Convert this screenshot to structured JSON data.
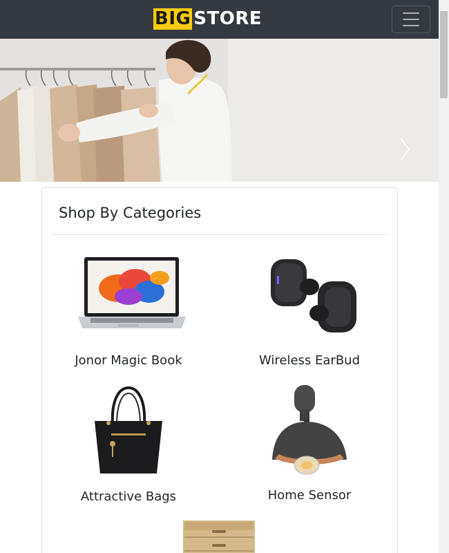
{
  "navbar": {
    "logo_big": "BIG",
    "logo_store": "STORE",
    "menu_icon": "hamburger-icon"
  },
  "hero": {
    "next_icon": "chevron-right-icon"
  },
  "categories": {
    "title": "Shop By Categories",
    "items": [
      {
        "label": "Jonor Magic Book",
        "icon": "laptop-image"
      },
      {
        "label": "Wireless EarBud",
        "icon": "earbuds-image"
      },
      {
        "label": "Attractive Bags",
        "icon": "handbag-image"
      },
      {
        "label": "Home Sensor",
        "icon": "lamp-image"
      },
      {
        "label": "",
        "icon": "drawer-cabinet-image"
      }
    ]
  },
  "colors": {
    "navbar_bg": "#343a40",
    "logo_accent": "#fccc0a"
  }
}
